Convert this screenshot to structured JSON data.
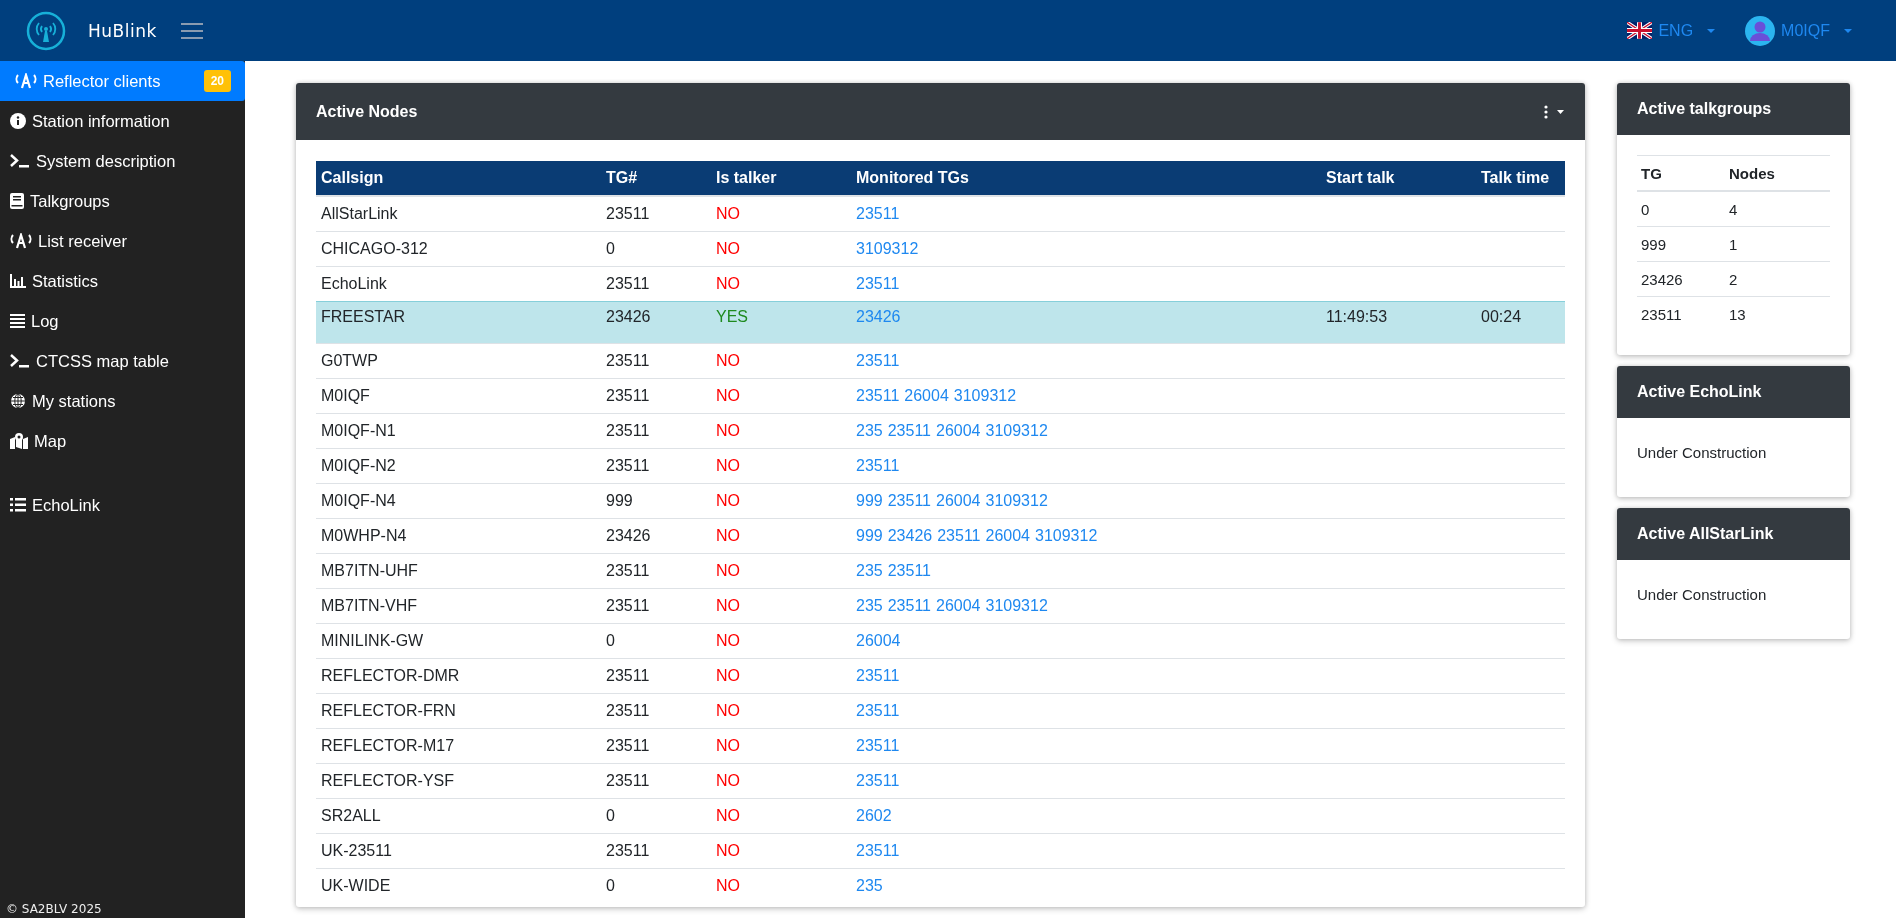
{
  "header": {
    "brand": "HuBlink",
    "language": "ENG",
    "user": "M0IQF"
  },
  "sidebar": {
    "groups": [
      [
        {
          "kind": "antenna",
          "label": "Reflector clients",
          "selected": true,
          "badge": "20"
        },
        {
          "kind": "info",
          "label": "Station information",
          "selected": false
        },
        {
          "kind": "terminal",
          "label": "System description",
          "selected": false
        },
        {
          "kind": "book",
          "label": "Talkgroups",
          "selected": false
        },
        {
          "kind": "antenna",
          "label": "List receiver",
          "selected": false
        },
        {
          "kind": "chart",
          "label": "Statistics",
          "selected": false
        },
        {
          "kind": "lines",
          "label": "Log",
          "selected": false
        },
        {
          "kind": "terminal",
          "label": "CTCSS map table",
          "selected": false
        },
        {
          "kind": "globe",
          "label": "My stations",
          "selected": false
        },
        {
          "kind": "map",
          "label": "Map",
          "selected": false
        }
      ],
      [
        {
          "kind": "list",
          "label": "EchoLink",
          "selected": false
        }
      ]
    ],
    "footer": "© SA2BLV 2025"
  },
  "active_nodes": {
    "title": "Active Nodes",
    "columns": [
      "Callsign",
      "TG#",
      "Is talker",
      "Monitored TGs",
      "Start talk",
      "Talk time"
    ],
    "rows": [
      {
        "callsign": "AllStarLink",
        "tg": "23511",
        "is_talker": false,
        "talker": "NO",
        "monitored": [
          "23511"
        ]
      },
      {
        "callsign": "CHICAGO-312",
        "tg": "0",
        "is_talker": false,
        "talker": "NO",
        "monitored": [
          "3109312"
        ]
      },
      {
        "callsign": "EchoLink",
        "tg": "23511",
        "is_talker": false,
        "talker": "NO",
        "monitored": [
          "23511"
        ]
      },
      {
        "callsign": "FREESTAR",
        "tg": "23426",
        "is_talker": true,
        "talker": "YES",
        "monitored": [
          "23426"
        ],
        "start_talk": "11:49:53",
        "talk_time": "00:24"
      },
      {
        "callsign": "G0TWP",
        "tg": "23511",
        "is_talker": false,
        "talker": "NO",
        "monitored": [
          "23511"
        ]
      },
      {
        "callsign": "M0IQF",
        "tg": "23511",
        "is_talker": false,
        "talker": "NO",
        "monitored": [
          "23511",
          "26004",
          "3109312"
        ]
      },
      {
        "callsign": "M0IQF-N1",
        "tg": "23511",
        "is_talker": false,
        "talker": "NO",
        "monitored": [
          "235",
          "23511",
          "26004",
          "3109312"
        ]
      },
      {
        "callsign": "M0IQF-N2",
        "tg": "23511",
        "is_talker": false,
        "talker": "NO",
        "monitored": [
          "23511"
        ]
      },
      {
        "callsign": "M0IQF-N4",
        "tg": "999",
        "is_talker": false,
        "talker": "NO",
        "monitored": [
          "999",
          "23511",
          "26004",
          "3109312"
        ]
      },
      {
        "callsign": "M0WHP-N4",
        "tg": "23426",
        "is_talker": false,
        "talker": "NO",
        "monitored": [
          "999",
          "23426",
          "23511",
          "26004",
          "3109312"
        ]
      },
      {
        "callsign": "MB7ITN-UHF",
        "tg": "23511",
        "is_talker": false,
        "talker": "NO",
        "monitored": [
          "235",
          "23511"
        ]
      },
      {
        "callsign": "MB7ITN-VHF",
        "tg": "23511",
        "is_talker": false,
        "talker": "NO",
        "monitored": [
          "235",
          "23511",
          "26004",
          "3109312"
        ]
      },
      {
        "callsign": "MINILINK-GW",
        "tg": "0",
        "is_talker": false,
        "talker": "NO",
        "monitored": [
          "26004"
        ]
      },
      {
        "callsign": "REFLECTOR-DMR",
        "tg": "23511",
        "is_talker": false,
        "talker": "NO",
        "monitored": [
          "23511"
        ]
      },
      {
        "callsign": "REFLECTOR-FRN",
        "tg": "23511",
        "is_talker": false,
        "talker": "NO",
        "monitored": [
          "23511"
        ]
      },
      {
        "callsign": "REFLECTOR-M17",
        "tg": "23511",
        "is_talker": false,
        "talker": "NO",
        "monitored": [
          "23511"
        ]
      },
      {
        "callsign": "REFLECTOR-YSF",
        "tg": "23511",
        "is_talker": false,
        "talker": "NO",
        "monitored": [
          "23511"
        ]
      },
      {
        "callsign": "SR2ALL",
        "tg": "0",
        "is_talker": false,
        "talker": "NO",
        "monitored": [
          "2602"
        ]
      },
      {
        "callsign": "UK-23511",
        "tg": "23511",
        "is_talker": false,
        "talker": "NO",
        "monitored": [
          "23511"
        ]
      },
      {
        "callsign": "UK-WIDE",
        "tg": "0",
        "is_talker": false,
        "talker": "NO",
        "monitored": [
          "235"
        ]
      }
    ]
  },
  "active_talkgroups": {
    "title": "Active talkgroups",
    "columns": [
      "TG",
      "Nodes"
    ],
    "rows": [
      [
        "0",
        "4"
      ],
      [
        "999",
        "1"
      ],
      [
        "23426",
        "2"
      ],
      [
        "23511",
        "13"
      ]
    ]
  },
  "active_echolink": {
    "title": "Active EchoLink",
    "text": "Under Construction"
  },
  "active_allstarlink": {
    "title": "Active AllStarLink",
    "text": "Under Construction"
  }
}
